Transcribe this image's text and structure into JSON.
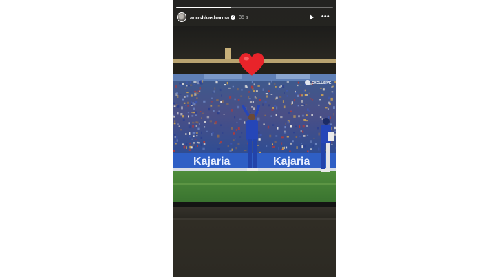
{
  "story": {
    "username": "anushkasharma",
    "time_ago": "35 s",
    "progress": 0.35,
    "verified": true
  },
  "header": {
    "play_icon": "play-icon",
    "more_icon": "more-icon",
    "verified_icon": "verified-badge-icon"
  },
  "broadcast": {
    "advertiser_board": [
      "Kajaria",
      "Kajaria"
    ],
    "channel_logo_text": "EXCLUSIVE"
  },
  "sticker": {
    "icon": "heart-icon",
    "color": "#e8242a"
  },
  "colors": {
    "accent": "#e8242a",
    "jersey_blue": "#2546b8",
    "pitch_green": "#4c8a3a",
    "board_blue": "#2f5fc5"
  }
}
